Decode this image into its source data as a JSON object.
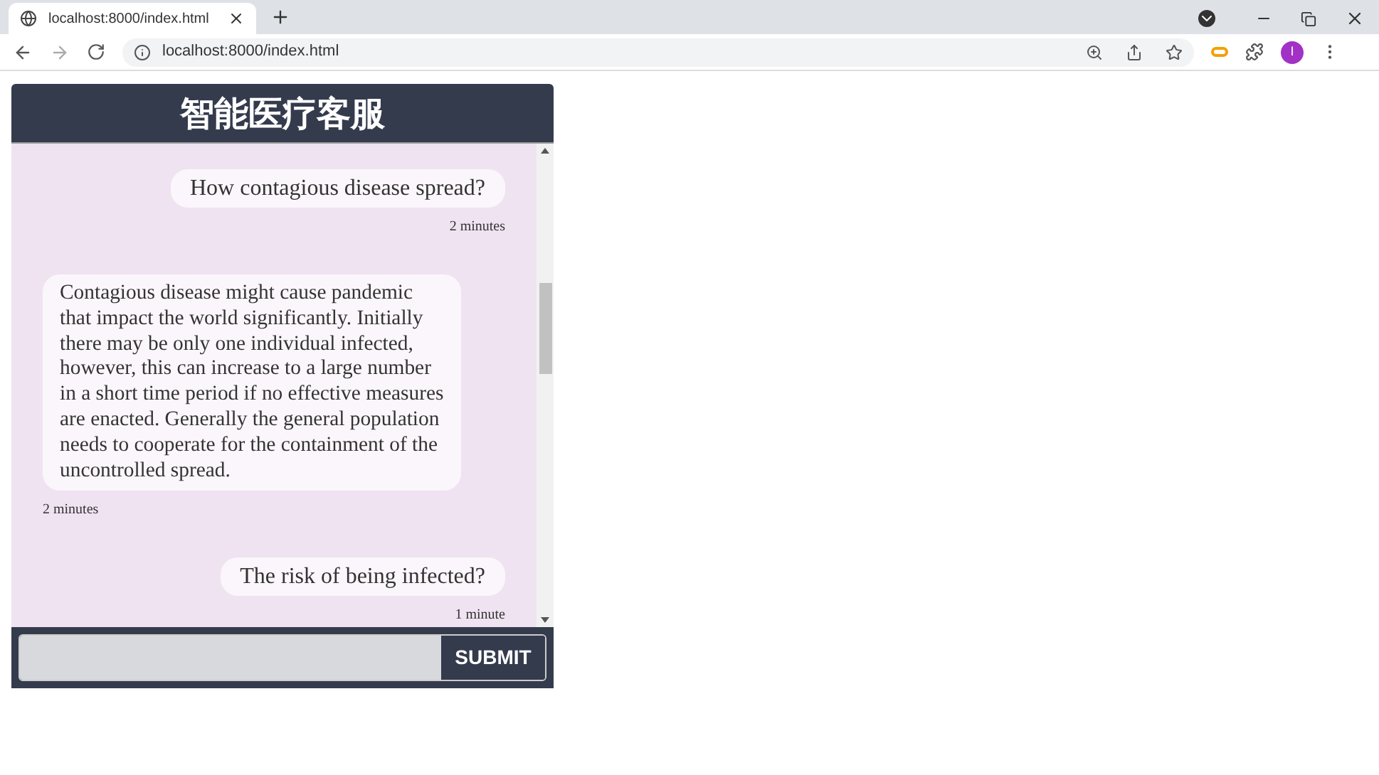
{
  "browser": {
    "tab_title": "localhost:8000/index.html",
    "url": "localhost:8000/index.html",
    "profile_initial": "I"
  },
  "chat": {
    "title": "智能医疗客服",
    "messages": [
      {
        "kind": "user",
        "text": "How contagious disease spread?",
        "time": "2 minutes"
      },
      {
        "kind": "bot",
        "text": "Contagious disease might cause pandemic that impact the world significantly. Initially there may be only one individual infected, however, this can increase to a large number in a short time period if no effective measures are enacted. Generally the general population needs to cooperate for the containment of the uncontrolled spread.",
        "time": "2 minutes"
      },
      {
        "kind": "user",
        "text": "The risk of being infected?",
        "time": "1 minute"
      }
    ],
    "submit_label": "SUBMIT"
  }
}
